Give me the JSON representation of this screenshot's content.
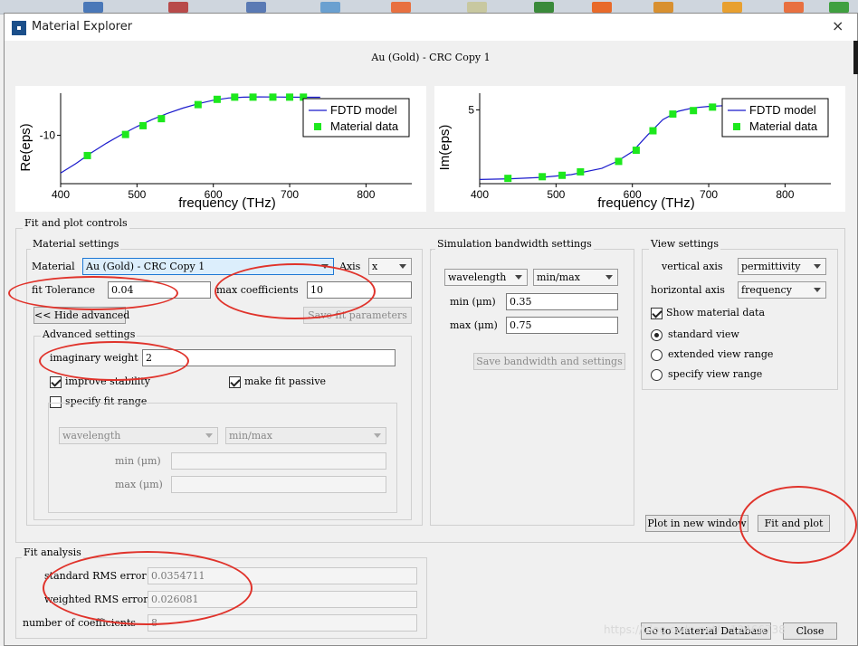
{
  "window": {
    "title": "Material Explorer",
    "close_glyph": "×"
  },
  "heading": "Au (Gold) - CRC Copy 1",
  "plots": {
    "legend_model": "FDTD model",
    "legend_data": "Material data",
    "xlabel": "frequency (THz)",
    "re": {
      "ylabel": "Re(eps)",
      "ytick": "-10",
      "xticks": [
        "400",
        "500",
        "600",
        "700",
        "800"
      ]
    },
    "im": {
      "ylabel": "Im(eps)",
      "ytick": "5",
      "xticks": [
        "400",
        "500",
        "600",
        "700",
        "800"
      ]
    }
  },
  "chart_data": [
    {
      "type": "line",
      "ylabel": "Re(eps)",
      "xlabel": "frequency (THz)",
      "xlim": [
        400,
        860
      ],
      "ylim": [
        -15.5,
        -5.2
      ],
      "yticks": [
        -10
      ],
      "xticks": [
        400,
        500,
        600,
        700,
        800
      ],
      "legend": "top-right",
      "series": [
        {
          "name": "FDTD model",
          "kind": "line",
          "color": "#1a1acc",
          "x": [
            400,
            420,
            440,
            460,
            480,
            500,
            520,
            540,
            560,
            580,
            600,
            620,
            640,
            660,
            680,
            700,
            720,
            740
          ],
          "y": [
            -14.3,
            -13.2,
            -12.0,
            -10.9,
            -9.9,
            -9.0,
            -8.2,
            -7.5,
            -6.9,
            -6.4,
            -6.0,
            -5.75,
            -5.65,
            -5.62,
            -5.63,
            -5.65,
            -5.66,
            -5.66
          ]
        },
        {
          "name": "Material data",
          "kind": "scatter",
          "color": "#1de81d",
          "x": [
            435,
            485,
            508,
            532,
            580,
            605,
            628,
            652,
            678,
            700,
            718
          ],
          "y": [
            -12.3,
            -9.9,
            -8.9,
            -8.1,
            -6.5,
            -5.9,
            -5.65,
            -5.65,
            -5.65,
            -5.65,
            -5.65
          ]
        }
      ]
    },
    {
      "type": "line",
      "ylabel": "Im(eps)",
      "xlabel": "frequency (THz)",
      "xlim": [
        400,
        860
      ],
      "ylim": [
        -0.3,
        6.2
      ],
      "yticks": [
        5
      ],
      "xticks": [
        400,
        500,
        600,
        700,
        800
      ],
      "legend": "top-right",
      "series": [
        {
          "name": "FDTD model",
          "kind": "line",
          "color": "#1a1acc",
          "x": [
            400,
            440,
            480,
            520,
            560,
            580,
            600,
            620,
            640,
            660,
            680,
            700,
            720,
            740
          ],
          "y": [
            0.0,
            0.05,
            0.15,
            0.35,
            0.8,
            1.3,
            2.0,
            3.2,
            4.3,
            4.9,
            5.15,
            5.25,
            5.3,
            5.3
          ]
        },
        {
          "name": "Material data",
          "kind": "scatter",
          "color": "#1de81d",
          "x": [
            437,
            482,
            508,
            532,
            582,
            605,
            627,
            653,
            680,
            705,
            730
          ],
          "y": [
            0.08,
            0.2,
            0.3,
            0.55,
            1.3,
            2.1,
            3.5,
            4.7,
            4.95,
            5.2,
            5.3
          ]
        }
      ]
    }
  ],
  "fit_controls": {
    "title": "Fit and plot controls"
  },
  "material_settings": {
    "title": "Material settings",
    "material_label": "Material",
    "material_value": "Au (Gold) - CRC Copy 1",
    "axis_label": "Axis",
    "axis_value": "x",
    "fit_tolerance_label": "fit Tolerance",
    "fit_tolerance_value": "0.04",
    "max_coefficients_label": "max coefficients",
    "max_coefficients_value": "10",
    "hide_advanced": "<< Hide advanced",
    "save_fit": "Save fit parameters"
  },
  "advanced": {
    "title": "Advanced settings",
    "imag_weight_label": "imaginary weight",
    "imag_weight_value": "2",
    "improve_stability": "improve stability",
    "make_passive": "make fit passive",
    "specify_range": "specify fit range",
    "unit_select": "wavelength",
    "mode_select": "min/max",
    "min_label": "min (μm)",
    "max_label": "max (μm)"
  },
  "simulation": {
    "title": "Simulation bandwidth settings",
    "unit_select": "wavelength",
    "mode_select": "min/max",
    "min_label": "min (μm)",
    "min_value": "0.35",
    "max_label": "max (μm)",
    "max_value": "0.75",
    "save_button": "Save bandwidth and settings"
  },
  "view": {
    "title": "View settings",
    "vertical_label": "vertical axis",
    "vertical_value": "permittivity",
    "horizontal_label": "horizontal axis",
    "horizontal_value": "frequency",
    "show_data": "Show material data",
    "standard": "standard view",
    "extended": "extended view range",
    "specify": "specify view range",
    "plot_new_window": "Plot in new window",
    "fit_and_plot": "Fit and plot"
  },
  "analysis": {
    "title": "Fit analysis",
    "std_rms_label": "standard RMS error",
    "std_rms_value": "0.0354711",
    "weighted_rms_label": "weighted RMS error",
    "weighted_rms_value": "0.026081",
    "num_coeff_label": "number of coefficients",
    "num_coeff_value": "8"
  },
  "bottom": {
    "go_database": "Go to Material Database",
    "close": "Close"
  },
  "watermark": "https://blog.csdn.net/...12466738",
  "colors": {
    "annotation_ring": "#e0332b",
    "model_line": "#1a1acc",
    "data_marker": "#1de81d"
  }
}
